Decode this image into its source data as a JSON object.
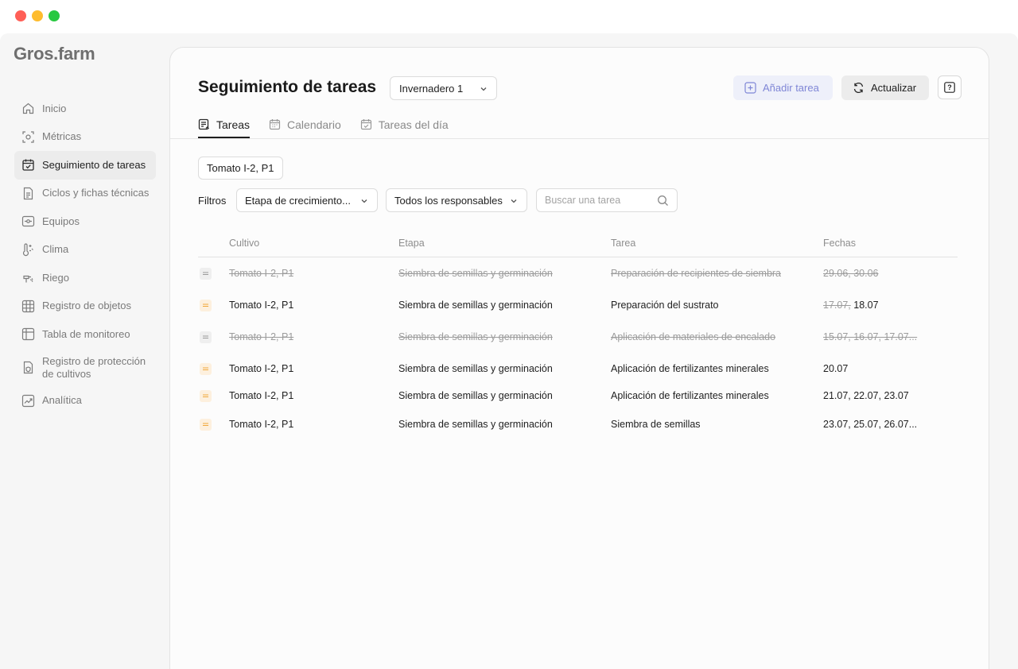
{
  "window": {
    "controls": [
      "close",
      "minimize",
      "maximize"
    ]
  },
  "brand": {
    "logo": "Gros.farm"
  },
  "sidebar": {
    "items": [
      {
        "label": "Inicio",
        "icon": "home-icon"
      },
      {
        "label": "Métricas",
        "icon": "metrics-icon"
      },
      {
        "label": "Seguimiento de tareas",
        "icon": "task-calendar-icon",
        "active": true
      },
      {
        "label": "Ciclos y fichas técnicas",
        "icon": "document-icon"
      },
      {
        "label": "Equipos",
        "icon": "equipment-icon"
      },
      {
        "label": "Clima",
        "icon": "climate-icon"
      },
      {
        "label": "Riego",
        "icon": "irrigation-icon"
      },
      {
        "label": "Registro de objetos",
        "icon": "grid-icon"
      },
      {
        "label": "Tabla de monitoreo",
        "icon": "table-icon"
      },
      {
        "label": "Registro de protección de cultivos",
        "icon": "protection-doc-icon"
      },
      {
        "label": "Analítica",
        "icon": "chart-icon"
      }
    ]
  },
  "header": {
    "title": "Seguimiento de tareas",
    "greenhouse_select": "Invernadero 1",
    "add_task_label": "Añadir tarea",
    "update_label": "Actualizar",
    "help_label": "?"
  },
  "tabs": [
    {
      "label": "Tareas",
      "active": true
    },
    {
      "label": "Calendario",
      "active": false
    },
    {
      "label": "Tareas del día",
      "active": false
    }
  ],
  "crop_chip": "Tomato I-2, P1",
  "filters": {
    "label": "Filtros",
    "stage_select": "Etapa de crecimiento...",
    "responsible_select": "Todos los responsables",
    "search_placeholder": "Buscar una tarea"
  },
  "table": {
    "columns": [
      "Cultivo",
      "Etapa",
      "Tarea",
      "Fechas"
    ],
    "rows": [
      {
        "status": "done",
        "crop": "Tomato I-2, P1",
        "stage": "Siembra de semillas y germinación",
        "task": "Preparación de recipientes de siembra",
        "dates": "29.06, 30.06"
      },
      {
        "status": "partial",
        "crop": "Tomato I-2, P1",
        "stage": "Siembra de semillas y germinación",
        "task": "Preparación del sustrato",
        "dates_done": "17.07,",
        "dates": "18.07"
      },
      {
        "status": "done",
        "crop": "Tomato I-2, P1",
        "stage": "Siembra de semillas y germinación",
        "task": "Aplicación de materiales de encalado",
        "dates": "15.07, 16.07, 17.07..."
      },
      {
        "status": "todo",
        "crop": "Tomato I-2, P1",
        "stage": "Siembra de semillas y germinación",
        "task": "Aplicación de fertilizantes minerales",
        "dates": "20.07"
      },
      {
        "status": "todo",
        "crop": "Tomato I-2, P1",
        "stage": "Siembra de semillas y germinación",
        "task": "Aplicación de fertilizantes minerales",
        "dates": "21.07, 22.07, 23.07"
      },
      {
        "status": "todo",
        "crop": "Tomato I-2, P1",
        "stage": "Siembra de semillas y germinación",
        "task": "Siembra de semillas",
        "dates": "23.07, 25.07, 26.07..."
      }
    ]
  },
  "colors": {
    "accent": "#7f86d6",
    "todo_marker": "#f1a73b",
    "done_text": "#9c9c9c"
  }
}
